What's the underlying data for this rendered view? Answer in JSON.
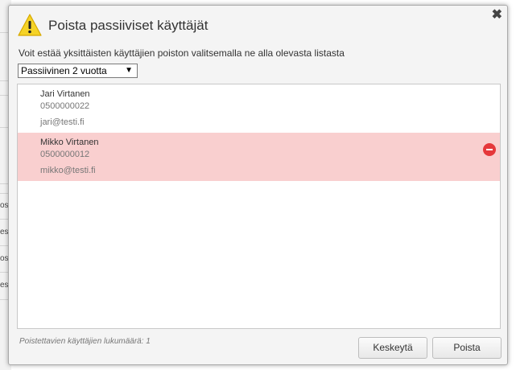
{
  "background": {
    "fragments": [
      "os",
      "es",
      "os",
      "es"
    ]
  },
  "dialog": {
    "title": "Poista passiiviset käyttäjät",
    "description": "Voit estää yksittäisten käyttäjien poiston valitsemalla ne alla olevasta listasta",
    "filter": {
      "selected": "Passiivinen 2 vuotta",
      "arrow": "▼"
    },
    "close_glyph": "✖",
    "users": [
      {
        "name": "Jari Virtanen",
        "phone": "0500000022",
        "email": "jari@testi.fi",
        "excluded": false
      },
      {
        "name": "Mikko Virtanen",
        "phone": "0500000012",
        "email": "mikko@testi.fi",
        "excluded": true
      }
    ],
    "count_text": "Poistettavien käyttäjien lukumäärä: 1",
    "buttons": {
      "cancel": "Keskeytä",
      "delete": "Poista"
    }
  },
  "colors": {
    "selected_row": "#f9cfcf",
    "remove_icon": "#e5383b",
    "warning": "#f5d327"
  }
}
